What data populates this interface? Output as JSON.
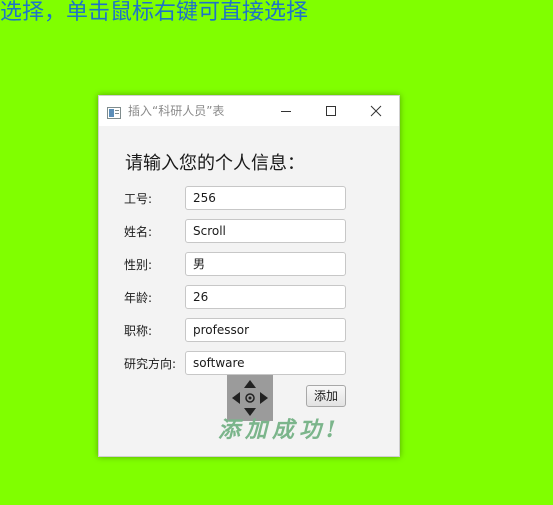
{
  "banner": {
    "text": "选择，单击鼠标右键可直接选择"
  },
  "window": {
    "title": "插入“科研人员”表",
    "heading": "请输入您的个人信息：",
    "fields": [
      {
        "label": "工号:",
        "value": "256"
      },
      {
        "label": "姓名:",
        "value": "Scroll"
      },
      {
        "label": "性别:",
        "value": "男"
      },
      {
        "label": "年龄:",
        "value": "26"
      },
      {
        "label": "职称:",
        "value": "professor"
      },
      {
        "label": "研究方向:",
        "value": "software"
      }
    ],
    "add_button_label": "添加",
    "success_message": "添加成功!"
  },
  "icons": {
    "app": "window-app-icon",
    "minimize": "minimize-icon",
    "maximize": "maximize-icon",
    "close": "close-icon",
    "move": "move-arrows-icon"
  },
  "colors": {
    "page_background": "#80ff00",
    "banner_text": "#1e73c8",
    "success_text": "#7bb58b"
  }
}
